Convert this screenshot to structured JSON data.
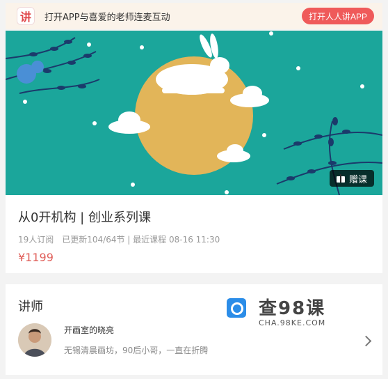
{
  "topbar": {
    "logo_char": "讲",
    "promo_text": "打开APP与喜爱的老师连麦互动",
    "open_app_label": "打开人人讲APP"
  },
  "banner": {
    "gift_label": "赠课"
  },
  "course": {
    "title": "从0开机构 | 创业系列课",
    "meta": "19人订阅　已更新104/64节 | 最近课程 08-16 11:30",
    "price": "¥1199"
  },
  "teacher_section": {
    "title": "讲师",
    "name": "开画室的晓亮",
    "bio": "无锡清晨画坊，90后小哥，一直在折腾"
  },
  "watermark": {
    "text": "查98课",
    "sub": "CHA.98KE.COM"
  },
  "colors": {
    "banner_bg": "#1ba69b",
    "moon": "#e2b559",
    "accent_red": "#ef5a5a",
    "price": "#e0605b",
    "watermark_blue": "#2b8de8"
  },
  "icons": [
    "app-logo-icon",
    "gift-icon",
    "chevron-right-icon",
    "watermark-logo-icon"
  ]
}
